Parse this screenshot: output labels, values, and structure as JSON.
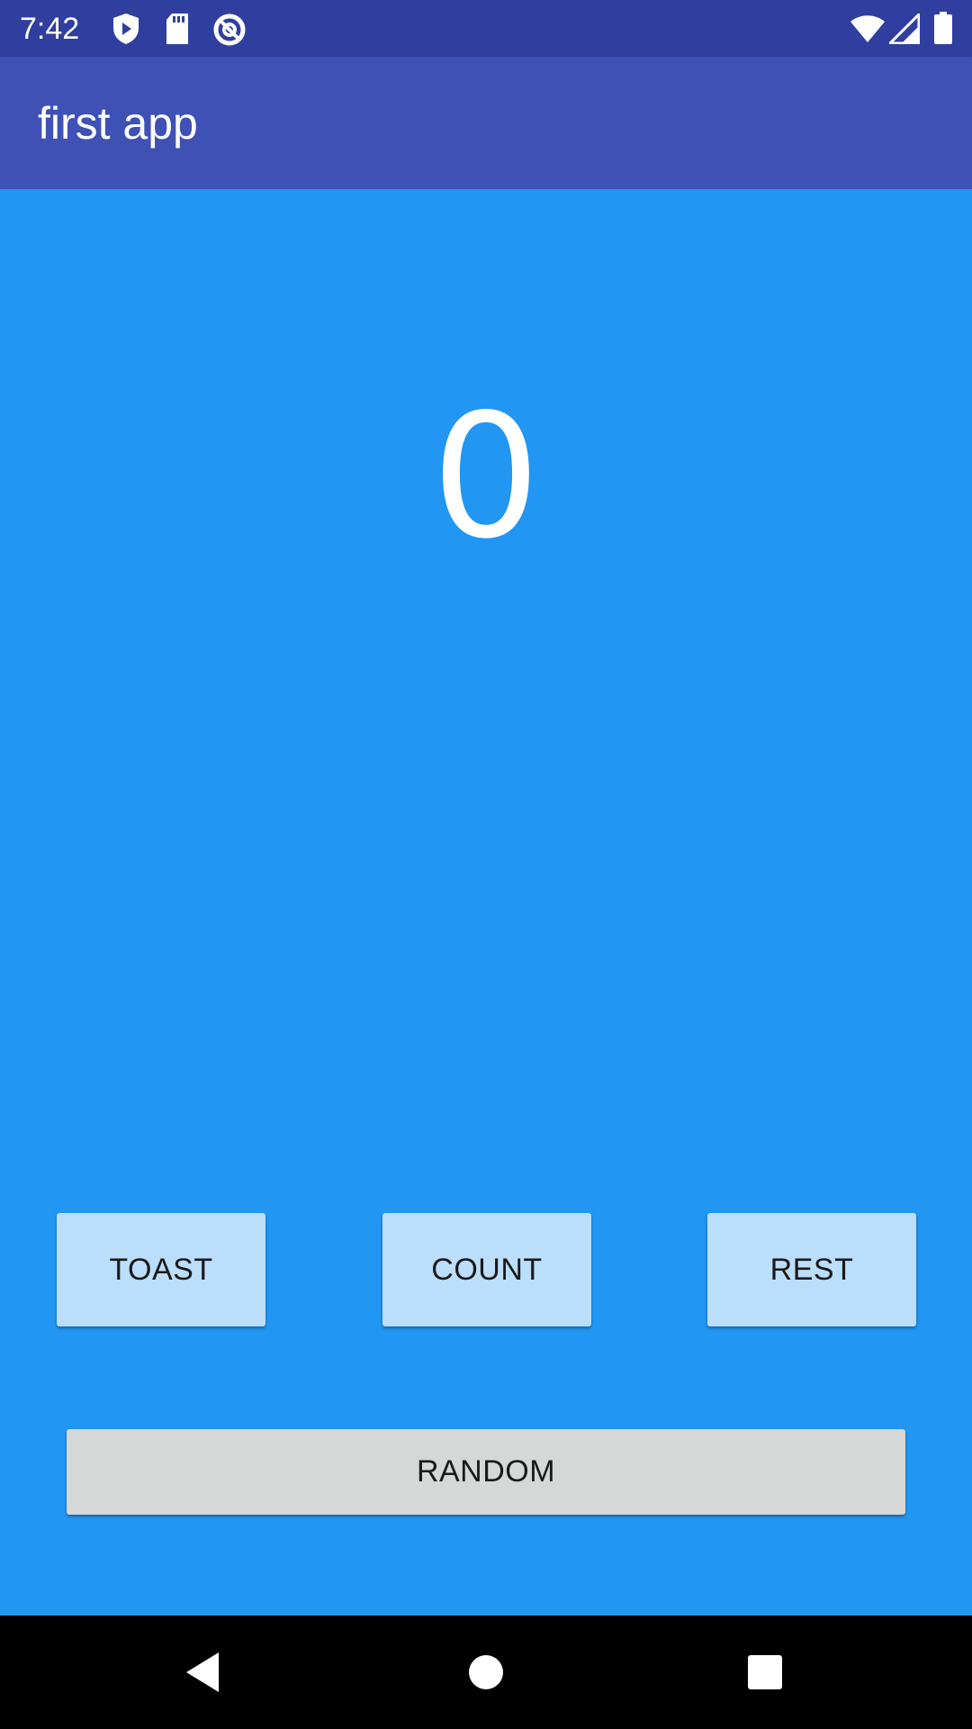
{
  "status_bar": {
    "time": "7:42",
    "icons": [
      "play-protect-icon",
      "sd-card-icon",
      "no-disturb-icon",
      "wifi-icon",
      "signal-icon",
      "battery-icon"
    ]
  },
  "app_bar": {
    "title": "first app"
  },
  "main": {
    "count_value": "0"
  },
  "buttons": {
    "toast_label": "TOAST",
    "count_label": "COUNT",
    "reset_label": "REST",
    "random_label": "RANDOM"
  },
  "colors": {
    "status_bar": "#303F9F",
    "app_bar": "#3F51B5",
    "background": "#2196F3",
    "button": "#BBDEFB",
    "random_button": "#D6D7D7"
  },
  "navigation": {
    "icons": [
      "back-icon",
      "home-icon",
      "recents-icon"
    ]
  }
}
